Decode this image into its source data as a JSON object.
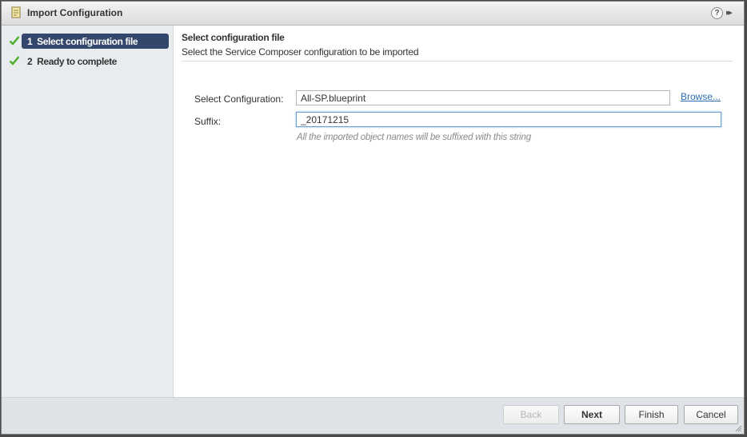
{
  "window": {
    "title": "Import Configuration",
    "help_icon": "?",
    "expand_icon": "▸▸"
  },
  "wizard": {
    "steps": [
      {
        "number": "1",
        "label": "Select configuration file",
        "status": "completed",
        "active": true
      },
      {
        "number": "2",
        "label": "Ready to complete",
        "status": "completed",
        "active": false
      }
    ]
  },
  "page": {
    "title": "Select configuration file",
    "subtitle": "Select the Service Composer configuration to be imported"
  },
  "form": {
    "configuration_label": "Select Configuration:",
    "configuration_value": "All-SP.blueprint",
    "browse_label": "Browse...",
    "suffix_label": "Suffix:",
    "suffix_value": "_20171215",
    "suffix_hint": "All the imported object names will be suffixed with this string"
  },
  "footer": {
    "back_label": "Back",
    "next_label": "Next",
    "finish_label": "Finish",
    "cancel_label": "Cancel"
  },
  "colors": {
    "active_step": "#33466b",
    "check": "#4caf2b",
    "link": "#2a6db5"
  }
}
